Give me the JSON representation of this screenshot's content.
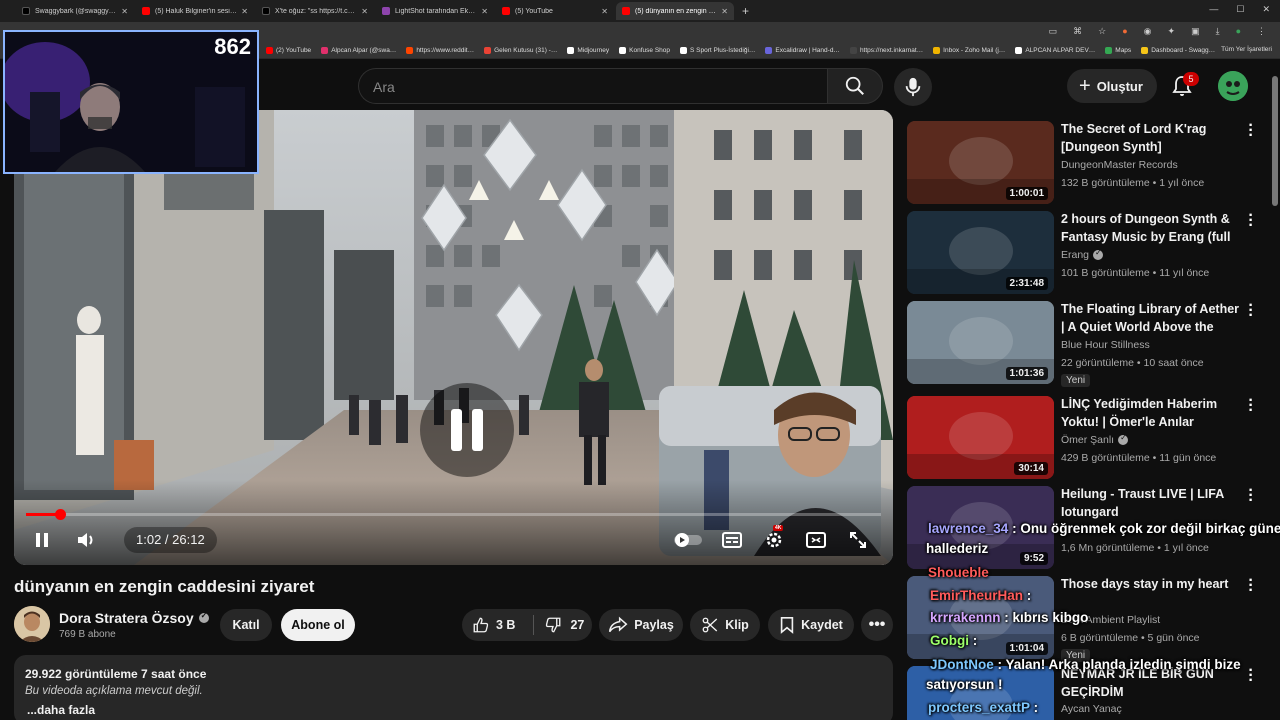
{
  "browser": {
    "tabs": [
      {
        "label": "Swaggybark (@swaggybark) / X",
        "color": "#000000",
        "active": false
      },
      {
        "label": "(5) Haluk Bilginer'in sesinden b…",
        "color": "#ff0000",
        "active": false
      },
      {
        "label": "X'te oğuz: \"ss https://t.co/8ZfZ…",
        "color": "#000000",
        "active": false
      },
      {
        "label": "LightShot tarafından Ekran Gö…",
        "color": "#8e44ad",
        "active": false
      },
      {
        "label": "(5) YouTube",
        "color": "#ff0000",
        "active": false
      },
      {
        "label": "(5) dünyanın en zengin cad…",
        "color": "#ff0000",
        "active": true
      }
    ],
    "bookmarks": [
      {
        "label": "(2) YouTube",
        "color": "#ff0000"
      },
      {
        "label": "Alpcan Alpar (@swa…",
        "color": "#e1306c"
      },
      {
        "label": "https://www.reddit…",
        "color": "#ff4500"
      },
      {
        "label": "Gelen Kutusu (31) -…",
        "color": "#ea4335"
      },
      {
        "label": "Midjourney",
        "color": "#ffffff"
      },
      {
        "label": "Konfuse Shop",
        "color": "#ffffff"
      },
      {
        "label": "S Sport Plus-İstediği…",
        "color": "#ffffff"
      },
      {
        "label": "Excalidraw | Hand-d…",
        "color": "#6965db"
      },
      {
        "label": "https://next.inkarnat…",
        "color": "#444444"
      },
      {
        "label": "Inbox - Zoho Mail (j…",
        "color": "#f0b400"
      },
      {
        "label": "ALPCAN ALPAR DEV…",
        "color": "#ffffff"
      },
      {
        "label": "Maps",
        "color": "#34a853"
      },
      {
        "label": "Dashboard - Swagg…",
        "color": "#f5c518"
      }
    ],
    "all_bookmarks": "Tüm Yer İşaretleri"
  },
  "header": {
    "search_placeholder": "Ara",
    "create_label": "Oluştur",
    "notification_count": "5"
  },
  "webcam": {
    "counter": "862"
  },
  "player": {
    "current_time": "1:02",
    "duration": "26:12",
    "time_display": "1:02 / 26:12",
    "progress_fraction": 0.04,
    "quality_badge": "4K"
  },
  "video": {
    "title": "dünyanın en zengin caddesini ziyaret",
    "channel_name": "Dora Stratera Özsoy",
    "subscribers": "769 B abone",
    "join_label": "Katıl",
    "subscribe_label": "Abone ol",
    "likes": "3 B",
    "dislikes": "27",
    "share_label": "Paylaş",
    "clip_label": "Klip",
    "save_label": "Kaydet",
    "stats": "29.922 görüntüleme  7 saat önce",
    "description": "Bu videoda açıklama mevcut değil.",
    "more_label": "...daha fazla"
  },
  "recommendations": [
    {
      "title": "The Secret of Lord K'rag [Dungeon Synth]",
      "channel": "DungeonMaster Records",
      "meta": "132 B görüntüleme • 1 yıl önce",
      "duration": "1:00:01",
      "verified": false,
      "new": "",
      "thumb_color": "#5a2a1e"
    },
    {
      "title": "2 hours of Dungeon Synth & Fantasy Music by Erang (full …",
      "channel": "Erang",
      "meta": "101 B görüntüleme • 11 yıl önce",
      "duration": "2:31:48",
      "verified": true,
      "new": "",
      "thumb_color": "#1d2e3c"
    },
    {
      "title": "The Floating Library of Aether | A Quiet World Above the Clouds",
      "channel": "Blue Hour Stillness",
      "meta": "22 görüntüleme • 10 saat önce",
      "duration": "1:01:36",
      "verified": false,
      "new": "Yeni",
      "thumb_color": "#7a8a96"
    },
    {
      "title": "LİNÇ Yediğimden Haberim Yoktu! | Ömer'le Anılar @gokalaf",
      "channel": "Ömer Şanlı",
      "meta": "429 B görüntüleme • 11 gün önce",
      "duration": "30:14",
      "verified": true,
      "new": "",
      "thumb_color": "#b01e1e"
    },
    {
      "title": "Heilung - Traust LIVE  |  LIFA Iotungard",
      "channel": "",
      "meta": "1,6 Mn görüntüleme • 1 yıl önce",
      "duration": "9:52",
      "verified": false,
      "new": "",
      "thumb_color": "#3a2d55"
    },
    {
      "title": "Those days stay in my heart",
      "channel": "Dark Ambient Playlist",
      "meta": "6 B görüntüleme • 5 gün önce",
      "duration": "1:01:04",
      "verified": false,
      "new": "Yeni",
      "thumb_color": "#4a5a7a"
    },
    {
      "title": "NEYMAR JR İLE BİR GÜN GEÇİRDİM",
      "channel": "Aycan Yanaç",
      "meta": "",
      "duration": "",
      "verified": false,
      "new": "",
      "thumb_color": "#2d5fa6"
    }
  ],
  "chat": [
    {
      "user": "lawrence_34",
      "sep": " : ",
      "msg": "Onu öğrenmek çok zor değil birkaç güne"
    },
    {
      "user": "",
      "sep": "",
      "msg": "hallederiz"
    },
    {
      "user": "Shoueble",
      "sep": "",
      "msg": ""
    },
    {
      "user": "EmirTheurHan",
      "sep": " : ",
      "msg": ""
    },
    {
      "user": "krrrakennn",
      "sep": " : ",
      "msg": "kıbrıs kibgo"
    },
    {
      "user": "Gobgi",
      "sep": " : ",
      "msg": ""
    },
    {
      "user": "JDontNoe",
      "sep": " : ",
      "msg": "Yalan! Arka planda izledin şimdi bize"
    },
    {
      "user": "",
      "sep": "",
      "msg": "satıyorsun !"
    },
    {
      "user": "procters_exattP",
      "sep": " : ",
      "msg": ""
    }
  ]
}
